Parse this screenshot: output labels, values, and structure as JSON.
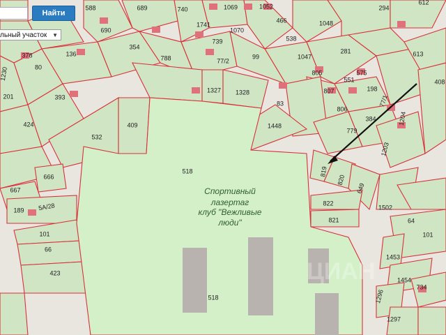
{
  "search": {
    "value": "",
    "button_label": "Найти"
  },
  "object_type": {
    "selected": "льный участок",
    "caret_icon": "chevron-down-icon"
  },
  "park_label": [
    "Спортивный",
    "лазертаг",
    "клуб \"Вежливые",
    "люди\""
  ],
  "watermark": "ЦИАН",
  "plots": [
    "588",
    "690",
    "689",
    "740",
    "1069",
    "1052",
    "294",
    "612",
    "466",
    "1048",
    "354",
    "1741",
    "1070",
    "538",
    "281",
    "613",
    "378",
    "136",
    "788",
    "739",
    "77/2",
    "99",
    "1047",
    "80",
    "805",
    "575",
    "408",
    "1230",
    "393",
    "551",
    "198",
    "201",
    "1327",
    "1328",
    "807",
    "77/1",
    "83",
    "424",
    "806",
    "384",
    "1204",
    "409",
    "1448",
    "779",
    "532",
    "1203",
    "518",
    "819",
    "820",
    "666",
    "667",
    "649",
    "822",
    "189",
    "5A/28",
    "1502",
    "821",
    "101",
    "64",
    "66",
    "101",
    "1453",
    "423",
    "1454",
    "734",
    "518",
    "1296",
    "1297"
  ],
  "colors": {
    "plot_line": "#d9303a",
    "plot_fill": "#cfe5c3",
    "park_fill": "#d4f0c8",
    "building": "#e0707a",
    "road": "#e9e6df"
  }
}
